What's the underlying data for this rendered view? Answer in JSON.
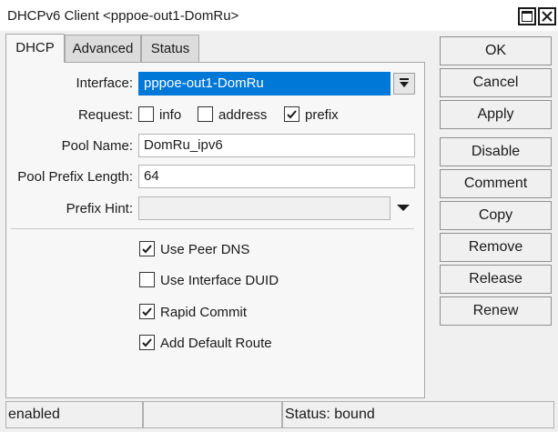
{
  "window": {
    "title": "DHCPv6 Client <pppoe-out1-DomRu>"
  },
  "tabs": [
    {
      "label": "DHCP",
      "active": true
    },
    {
      "label": "Advanced",
      "active": false
    },
    {
      "label": "Status",
      "active": false
    }
  ],
  "form": {
    "interface": {
      "label": "Interface:",
      "value": "pppoe-out1-DomRu"
    },
    "request": {
      "label": "Request:",
      "options": [
        {
          "label": "info",
          "checked": false
        },
        {
          "label": "address",
          "checked": false
        },
        {
          "label": "prefix",
          "checked": true
        }
      ]
    },
    "pool_name": {
      "label": "Pool Name:",
      "value": "DomRu_ipv6"
    },
    "pool_prefix_length": {
      "label": "Pool Prefix Length:",
      "value": "64"
    },
    "prefix_hint": {
      "label": "Prefix Hint:",
      "value": ""
    },
    "checkboxes": [
      {
        "label": "Use Peer DNS",
        "checked": true
      },
      {
        "label": "Use Interface DUID",
        "checked": false
      },
      {
        "label": "Rapid Commit",
        "checked": true
      },
      {
        "label": "Add Default Route",
        "checked": true
      }
    ]
  },
  "buttons": [
    "OK",
    "Cancel",
    "Apply",
    "Disable",
    "Comment",
    "Copy",
    "Remove",
    "Release",
    "Renew"
  ],
  "statusbar": {
    "state": "enabled",
    "middle": "",
    "status": "Status: bound"
  },
  "colors": {
    "selection": "#0078d7",
    "window_bg": "#f0f0f0",
    "panel_bg": "#f7f7f7"
  }
}
